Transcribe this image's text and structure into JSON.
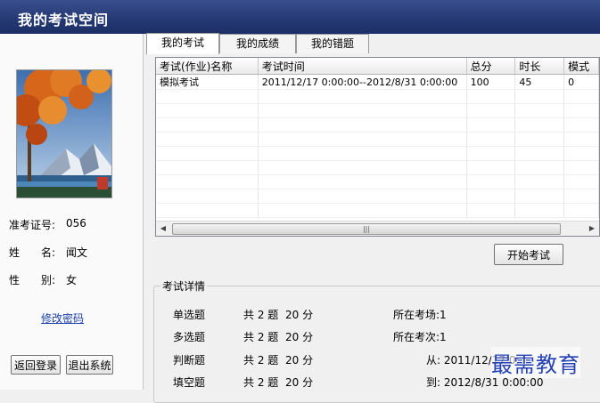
{
  "window": {
    "title": "我的考试空间"
  },
  "profile": {
    "id_label": "准考证号:",
    "id_value": "056",
    "name_label": "姓　　名:",
    "name_value": "闻文",
    "gender_label": "性　　别:",
    "gender_value": "女",
    "change_password": "修改密码",
    "back_button": "返回登录",
    "exit_button": "退出系统"
  },
  "tabs": [
    "我的考试",
    "我的成绩",
    "我的错题"
  ],
  "table": {
    "columns": [
      "考试(作业)名称",
      "考试时间",
      "总分",
      "时长",
      "模式"
    ],
    "rows": [
      [
        "模拟考试",
        "2011/12/17 0:00:00--2012/8/31 0:00:00",
        "100",
        "45",
        "0"
      ]
    ],
    "scroll_grip": "|||"
  },
  "start_button": "开始考试",
  "details": {
    "title": "考试详情",
    "questions": [
      {
        "type": "单选题",
        "count": "共 2 题",
        "score": "20 分"
      },
      {
        "type": "多选题",
        "count": "共 2 题",
        "score": "20 分"
      },
      {
        "type": "判断题",
        "count": "共 2 题",
        "score": "20 分"
      },
      {
        "type": "填空题",
        "count": "共 2 题",
        "score": "20 分"
      }
    ],
    "room": "所在考场:1",
    "session": "所在考次:1",
    "from": "从: 2011/12/17 0:",
    "to": "到: 2012/8/31 0:00:00"
  },
  "watermark": "最需教育",
  "colors": {
    "titlebar": "#243873",
    "link": "#1c3fa8",
    "watermark": "#2340b5"
  }
}
